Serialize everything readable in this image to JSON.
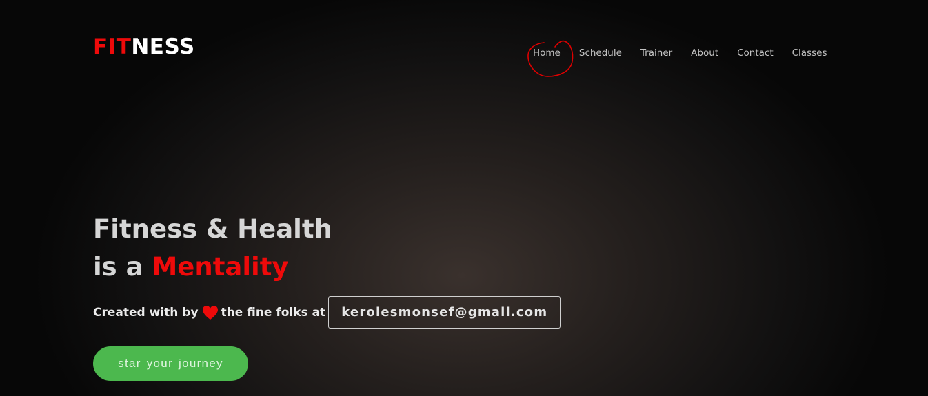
{
  "logo": {
    "part1": "FIT",
    "part2": "NESS"
  },
  "nav": {
    "items": [
      "Home",
      "Schedule",
      "Trainer",
      "About",
      "Contact",
      "Classes"
    ]
  },
  "hero": {
    "line1": "Fitness & Health",
    "line2_prefix": "is a ",
    "line2_accent": "Mentality",
    "credits_before": "Created with by",
    "credits_after": "the fine folks at",
    "email": "kerolesmonsef@gmail.com",
    "cta_label": "star your journey"
  },
  "icons": {
    "heart": "heart-icon",
    "annotation": "hand-drawn-circle-annotation"
  },
  "colors": {
    "accent_red": "#ee0a0a",
    "cta_green": "#4cb84e",
    "annotation_red": "#e00000"
  }
}
